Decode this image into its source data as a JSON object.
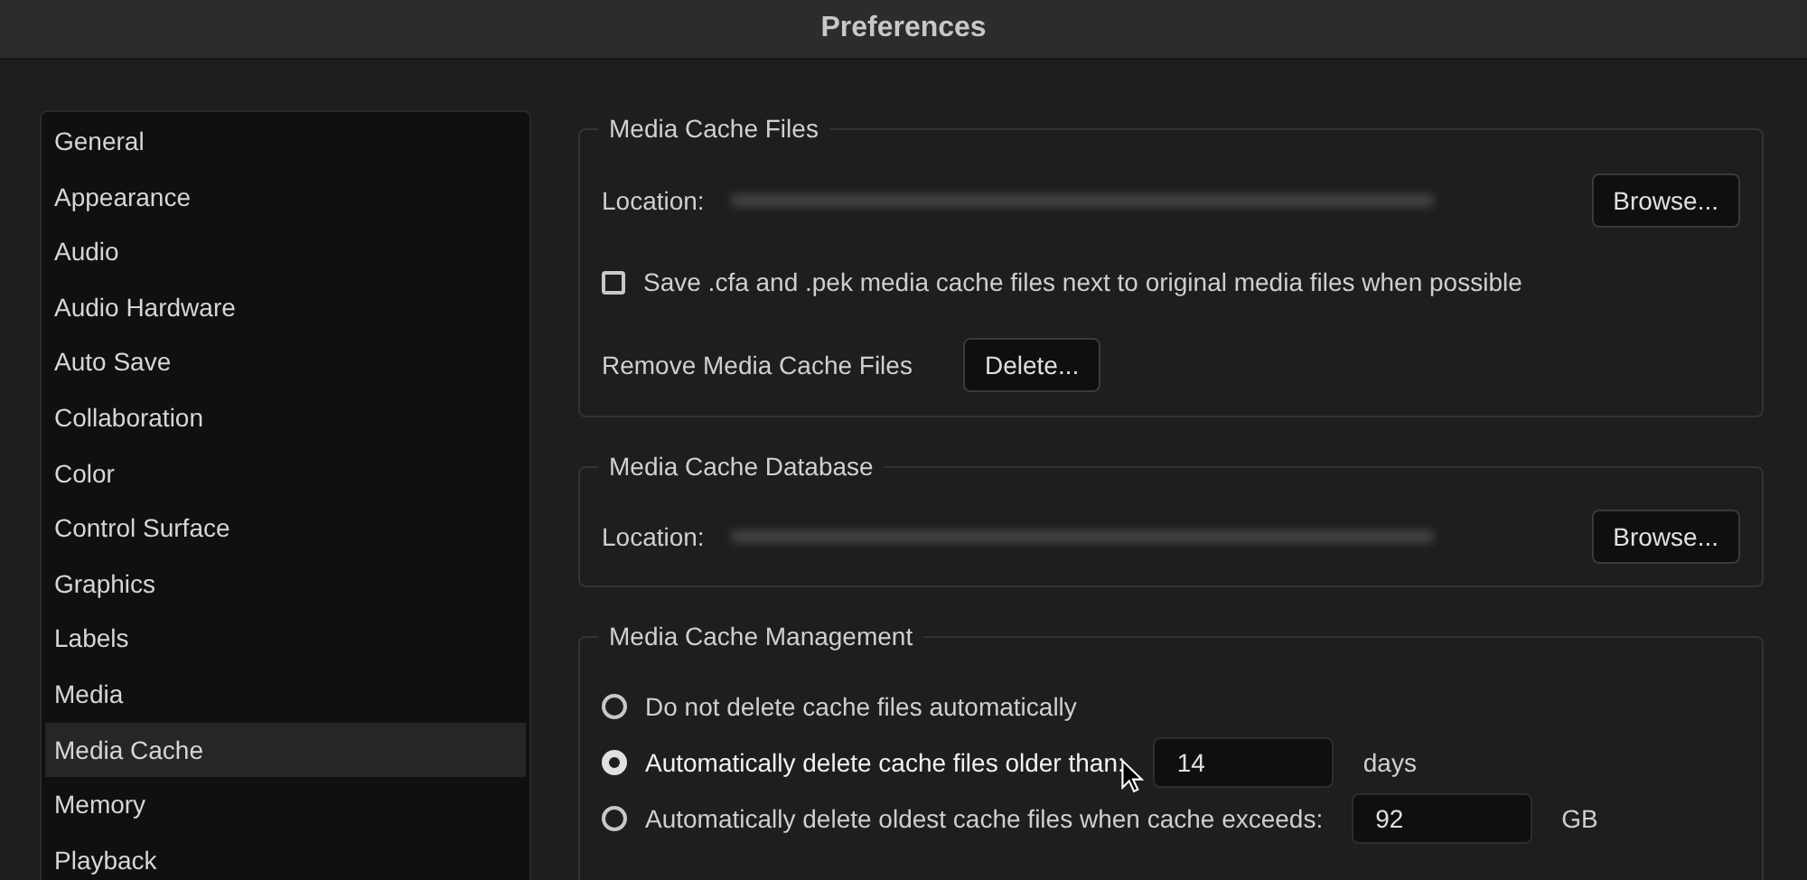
{
  "window": {
    "title": "Preferences"
  },
  "sidebar": {
    "items": [
      {
        "label": "General",
        "selected": false
      },
      {
        "label": "Appearance",
        "selected": false
      },
      {
        "label": "Audio",
        "selected": false
      },
      {
        "label": "Audio Hardware",
        "selected": false
      },
      {
        "label": "Auto Save",
        "selected": false
      },
      {
        "label": "Collaboration",
        "selected": false
      },
      {
        "label": "Color",
        "selected": false
      },
      {
        "label": "Control Surface",
        "selected": false
      },
      {
        "label": "Graphics",
        "selected": false
      },
      {
        "label": "Labels",
        "selected": false
      },
      {
        "label": "Media",
        "selected": false
      },
      {
        "label": "Media Cache",
        "selected": true
      },
      {
        "label": "Memory",
        "selected": false
      },
      {
        "label": "Playback",
        "selected": false
      }
    ]
  },
  "media_cache_files": {
    "title": "Media Cache Files",
    "location_label": "Location:",
    "browse_button": "Browse...",
    "checkbox": {
      "label": "Save .cfa and .pek media cache files next to original media files when possible",
      "checked": false
    },
    "remove_label": "Remove Media Cache Files",
    "delete_button": "Delete..."
  },
  "media_cache_database": {
    "title": "Media Cache Database",
    "location_label": "Location:",
    "browse_button": "Browse..."
  },
  "media_cache_management": {
    "title": "Media Cache Management",
    "options": [
      {
        "label": "Do not delete cache files automatically",
        "selected": false
      },
      {
        "label": "Automatically delete cache files older than:",
        "selected": true,
        "value": "14",
        "unit": "days"
      },
      {
        "label": "Automatically delete oldest cache files when cache exceeds:",
        "selected": false,
        "value": "92",
        "unit": "GB"
      }
    ]
  }
}
